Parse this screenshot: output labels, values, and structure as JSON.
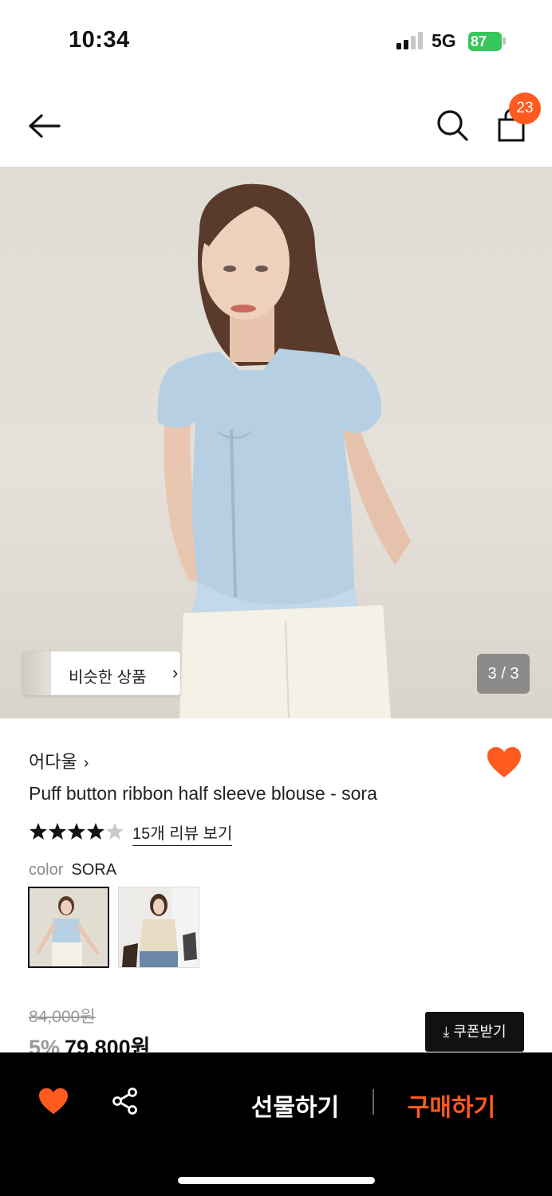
{
  "status_bar": {
    "time": "10:34",
    "network": "5G",
    "battery": "87"
  },
  "nav": {
    "back_icon": "arrow-left-icon",
    "search_icon": "search-icon",
    "cart_icon": "shopping-bag-icon",
    "cart_count": "23"
  },
  "hero": {
    "similar_label": "비슷한 상품",
    "pager": "3 / 3"
  },
  "product": {
    "brand": "어다울",
    "title": "Puff button ribbon half sleeve blouse - sora",
    "rating": 4.5,
    "review_link": "15개 리뷰 보기",
    "color_label": "color",
    "color_value": "SORA",
    "original_price": "84,000원",
    "discount": "5%",
    "sale_price": "79,800원",
    "coupon_label": "⤓ 쿠폰받기"
  },
  "bottom_bar": {
    "gift_label": "선물하기",
    "buy_label": "구매하기"
  },
  "colors": {
    "accent": "#ff5a1f",
    "battery": "#35c759"
  }
}
